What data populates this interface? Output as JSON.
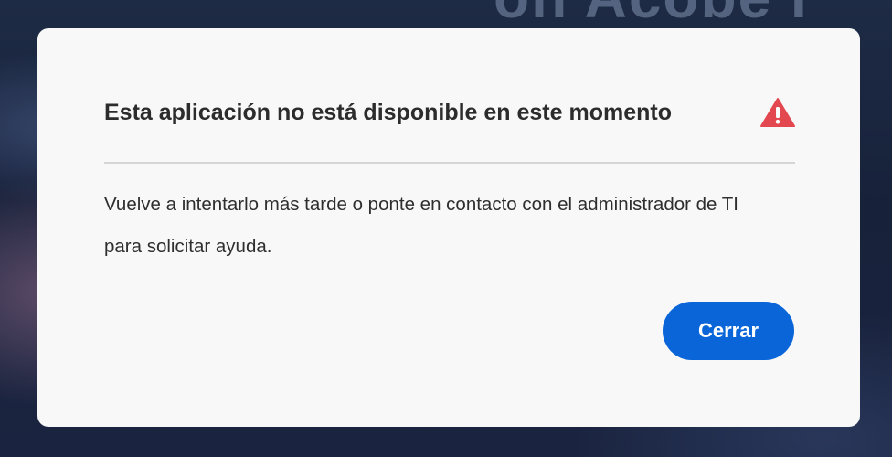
{
  "background": {
    "partial_text": "on Acobe I"
  },
  "dialog": {
    "title": "Esta aplicación no está disponible en este momento",
    "title_icon": "alert-triangle-icon",
    "body": "Vuelve a intentarlo más tarde o ponte en contacto con el administrador de TI para solicitar ayuda.",
    "close_label": "Cerrar"
  },
  "colors": {
    "accent": "#0a66d8",
    "warning": "#e34850",
    "dialog_background": "#f8f8f8",
    "backdrop": "#1e2b45"
  }
}
